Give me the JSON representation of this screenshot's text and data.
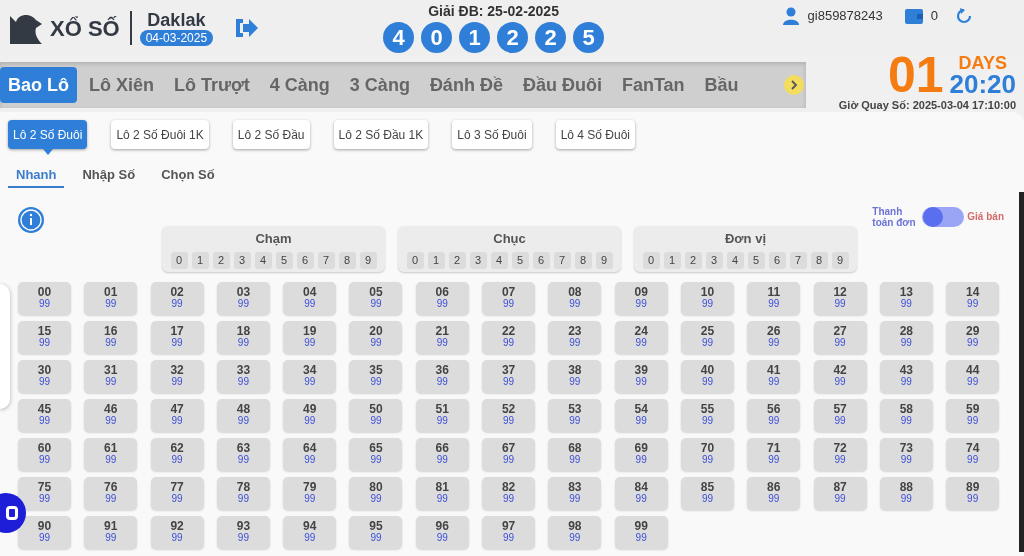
{
  "header": {
    "brand": "XỔ SỐ",
    "province": "Daklak",
    "date": "04-03-2025",
    "result_title": "Giải ĐB: 25-02-2025",
    "result_digits": [
      "4",
      "0",
      "1",
      "2",
      "2",
      "5"
    ],
    "username": "gi859878243",
    "balance": "0"
  },
  "tabs": [
    {
      "label": "Bao Lô",
      "selected": true
    },
    {
      "label": "Lô Xiên",
      "selected": false
    },
    {
      "label": "Lô Trượt",
      "selected": false
    },
    {
      "label": "4 Càng",
      "selected": false
    },
    {
      "label": "3 Càng",
      "selected": false
    },
    {
      "label": "Đánh Đề",
      "selected": false
    },
    {
      "label": "Đầu Đuôi",
      "selected": false
    },
    {
      "label": "FanTan",
      "selected": false
    },
    {
      "label": "Bầu",
      "selected": false
    }
  ],
  "countdown": {
    "days": "01",
    "days_label": "DAYS",
    "time": "20:20",
    "draw_time": "Giờ Quay Số: 2025-03-04 17:10:00"
  },
  "bet_types": [
    {
      "label": "Lô 2 Số Đuôi",
      "selected": true
    },
    {
      "label": "Lô 2 Số Đuôi 1K",
      "selected": false
    },
    {
      "label": "Lô 2 Số Đầu",
      "selected": false
    },
    {
      "label": "Lô 2 Số Đầu 1K",
      "selected": false
    },
    {
      "label": "Lô 3 Số Đuôi",
      "selected": false
    },
    {
      "label": "Lô 4 Số Đuôi",
      "selected": false
    }
  ],
  "modes": [
    {
      "label": "Nhanh",
      "selected": true
    },
    {
      "label": "Nhập Số",
      "selected": false
    },
    {
      "label": "Chọn Số",
      "selected": false
    }
  ],
  "toggle": {
    "left_label": "Thanh toán đơn",
    "right_label": "Giá bán",
    "on": false
  },
  "digit_groups": [
    {
      "title": "Chạm",
      "digits": [
        "0",
        "1",
        "2",
        "3",
        "4",
        "5",
        "6",
        "7",
        "8",
        "9"
      ]
    },
    {
      "title": "Chục",
      "digits": [
        "0",
        "1",
        "2",
        "3",
        "4",
        "5",
        "6",
        "7",
        "8",
        "9"
      ]
    },
    {
      "title": "Đơn vị",
      "digits": [
        "0",
        "1",
        "2",
        "3",
        "4",
        "5",
        "6",
        "7",
        "8",
        "9"
      ]
    }
  ],
  "numbers": [
    {
      "number": "00",
      "price": "99"
    },
    {
      "number": "01",
      "price": "99"
    },
    {
      "number": "02",
      "price": "99"
    },
    {
      "number": "03",
      "price": "99"
    },
    {
      "number": "04",
      "price": "99"
    },
    {
      "number": "05",
      "price": "99"
    },
    {
      "number": "06",
      "price": "99"
    },
    {
      "number": "07",
      "price": "99"
    },
    {
      "number": "08",
      "price": "99"
    },
    {
      "number": "09",
      "price": "99"
    },
    {
      "number": "10",
      "price": "99"
    },
    {
      "number": "11",
      "price": "99"
    },
    {
      "number": "12",
      "price": "99"
    },
    {
      "number": "13",
      "price": "99"
    },
    {
      "number": "14",
      "price": "99"
    },
    {
      "number": "15",
      "price": "99"
    },
    {
      "number": "16",
      "price": "99"
    },
    {
      "number": "17",
      "price": "99"
    },
    {
      "number": "18",
      "price": "99"
    },
    {
      "number": "19",
      "price": "99"
    },
    {
      "number": "20",
      "price": "99"
    },
    {
      "number": "21",
      "price": "99"
    },
    {
      "number": "22",
      "price": "99"
    },
    {
      "number": "23",
      "price": "99"
    },
    {
      "number": "24",
      "price": "99"
    },
    {
      "number": "25",
      "price": "99"
    },
    {
      "number": "26",
      "price": "99"
    },
    {
      "number": "27",
      "price": "99"
    },
    {
      "number": "28",
      "price": "99"
    },
    {
      "number": "29",
      "price": "99"
    },
    {
      "number": "30",
      "price": "99"
    },
    {
      "number": "31",
      "price": "99"
    },
    {
      "number": "32",
      "price": "99"
    },
    {
      "number": "33",
      "price": "99"
    },
    {
      "number": "34",
      "price": "99"
    },
    {
      "number": "35",
      "price": "99"
    },
    {
      "number": "36",
      "price": "99"
    },
    {
      "number": "37",
      "price": "99"
    },
    {
      "number": "38",
      "price": "99"
    },
    {
      "number": "39",
      "price": "99"
    },
    {
      "number": "40",
      "price": "99"
    },
    {
      "number": "41",
      "price": "99"
    },
    {
      "number": "42",
      "price": "99"
    },
    {
      "number": "43",
      "price": "99"
    },
    {
      "number": "44",
      "price": "99"
    },
    {
      "number": "45",
      "price": "99"
    },
    {
      "number": "46",
      "price": "99"
    },
    {
      "number": "47",
      "price": "99"
    },
    {
      "number": "48",
      "price": "99"
    },
    {
      "number": "49",
      "price": "99"
    },
    {
      "number": "50",
      "price": "99"
    },
    {
      "number": "51",
      "price": "99"
    },
    {
      "number": "52",
      "price": "99"
    },
    {
      "number": "53",
      "price": "99"
    },
    {
      "number": "54",
      "price": "99"
    },
    {
      "number": "55",
      "price": "99"
    },
    {
      "number": "56",
      "price": "99"
    },
    {
      "number": "57",
      "price": "99"
    },
    {
      "number": "58",
      "price": "99"
    },
    {
      "number": "59",
      "price": "99"
    },
    {
      "number": "60",
      "price": "99"
    },
    {
      "number": "61",
      "price": "99"
    },
    {
      "number": "62",
      "price": "99"
    },
    {
      "number": "63",
      "price": "99"
    },
    {
      "number": "64",
      "price": "99"
    },
    {
      "number": "65",
      "price": "99"
    },
    {
      "number": "66",
      "price": "99"
    },
    {
      "number": "67",
      "price": "99"
    },
    {
      "number": "68",
      "price": "99"
    },
    {
      "number": "69",
      "price": "99"
    },
    {
      "number": "70",
      "price": "99"
    },
    {
      "number": "71",
      "price": "99"
    },
    {
      "number": "72",
      "price": "99"
    },
    {
      "number": "73",
      "price": "99"
    },
    {
      "number": "74",
      "price": "99"
    },
    {
      "number": "75",
      "price": "99"
    },
    {
      "number": "76",
      "price": "99"
    },
    {
      "number": "77",
      "price": "99"
    },
    {
      "number": "78",
      "price": "99"
    },
    {
      "number": "79",
      "price": "99"
    },
    {
      "number": "80",
      "price": "99"
    },
    {
      "number": "81",
      "price": "99"
    },
    {
      "number": "82",
      "price": "99"
    },
    {
      "number": "83",
      "price": "99"
    },
    {
      "number": "84",
      "price": "99"
    },
    {
      "number": "85",
      "price": "99"
    },
    {
      "number": "86",
      "price": "99"
    },
    {
      "number": "87",
      "price": "99"
    },
    {
      "number": "88",
      "price": "99"
    },
    {
      "number": "89",
      "price": "99"
    },
    {
      "number": "90",
      "price": "99"
    },
    {
      "number": "91",
      "price": "99"
    },
    {
      "number": "92",
      "price": "99"
    },
    {
      "number": "93",
      "price": "99"
    },
    {
      "number": "94",
      "price": "99"
    },
    {
      "number": "95",
      "price": "99"
    },
    {
      "number": "96",
      "price": "99"
    },
    {
      "number": "97",
      "price": "99"
    },
    {
      "number": "98",
      "price": "99"
    },
    {
      "number": "99",
      "price": "99"
    }
  ]
}
